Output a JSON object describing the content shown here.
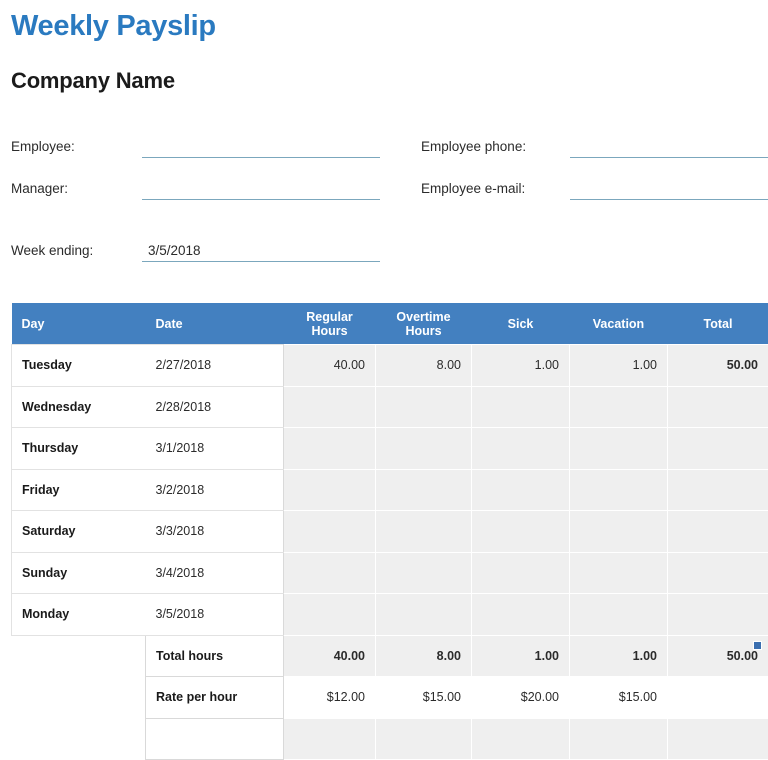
{
  "document": {
    "title": "Weekly Payslip",
    "company": "Company Name"
  },
  "form": {
    "left_fields": [
      {
        "label": "Employee:",
        "value": ""
      },
      {
        "label": "Manager:",
        "value": ""
      }
    ],
    "right_fields": [
      {
        "label": "Employee phone:",
        "value": ""
      },
      {
        "label": "Employee e-mail:",
        "value": ""
      }
    ],
    "week_ending": {
      "label": "Week ending:",
      "value": "3/5/2018"
    }
  },
  "table": {
    "columns": [
      "Day",
      "Date",
      "Regular Hours",
      "Overtime Hours",
      "Sick",
      "Vacation",
      "Total"
    ],
    "column_header_lines": {
      "regular": [
        "Regular",
        "Hours"
      ],
      "overtime": [
        "Overtime",
        "Hours"
      ]
    },
    "rows": [
      {
        "day": "Tuesday",
        "date": "2/27/2018",
        "regular": "40.00",
        "overtime": "8.00",
        "sick": "1.00",
        "vacation": "1.00",
        "total": "50.00"
      },
      {
        "day": "Wednesday",
        "date": "2/28/2018",
        "regular": "",
        "overtime": "",
        "sick": "",
        "vacation": "",
        "total": ""
      },
      {
        "day": "Thursday",
        "date": "3/1/2018",
        "regular": "",
        "overtime": "",
        "sick": "",
        "vacation": "",
        "total": ""
      },
      {
        "day": "Friday",
        "date": "3/2/2018",
        "regular": "",
        "overtime": "",
        "sick": "",
        "vacation": "",
        "total": ""
      },
      {
        "day": "Saturday",
        "date": "3/3/2018",
        "regular": "",
        "overtime": "",
        "sick": "",
        "vacation": "",
        "total": ""
      },
      {
        "day": "Sunday",
        "date": "3/4/2018",
        "regular": "",
        "overtime": "",
        "sick": "",
        "vacation": "",
        "total": ""
      },
      {
        "day": "Monday",
        "date": "3/5/2018",
        "regular": "",
        "overtime": "",
        "sick": "",
        "vacation": "",
        "total": ""
      }
    ],
    "summary": [
      {
        "label": "Total hours",
        "regular": "40.00",
        "overtime": "8.00",
        "sick": "1.00",
        "vacation": "1.00",
        "total": "50.00"
      },
      {
        "label": "Rate per hour",
        "regular": "$12.00",
        "overtime": "$15.00",
        "sick": "$20.00",
        "vacation": "$15.00",
        "total": ""
      }
    ]
  },
  "colors": {
    "title_blue": "#2a7ac0",
    "header_blue": "#4380c0",
    "cell_shade": "#efefef",
    "field_underline": "#7ba7bd"
  }
}
